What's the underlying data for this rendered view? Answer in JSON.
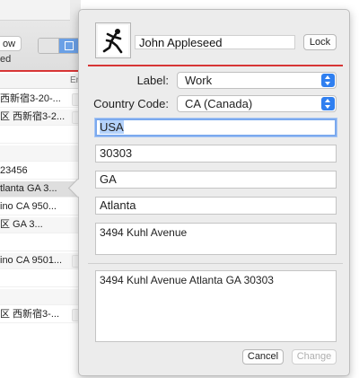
{
  "background_window": {
    "toolbar_button_label": "ow",
    "toolbar_text": "ed",
    "column_header": "Er",
    "rows": [
      "西新宿3-20-...",
      "区 西新宿3-2...",
      "",
      "",
      "23456",
      "tlanta GA 3...",
      "ino CA 950...",
      "区 GA 3...",
      "",
      "ino CA 9501...",
      "",
      "",
      "区 西新宿3-..."
    ]
  },
  "contact": {
    "name": "John Appleseed",
    "lock_label": "Lock"
  },
  "form": {
    "label_caption": "Label:",
    "label_value": "Work",
    "country_caption": "Country Code:",
    "country_value": "CA (Canada)",
    "country_field": "USA",
    "zip_field": "30303",
    "state_field": "GA",
    "city_field": "Atlanta",
    "street_field": "3494 Kuhl Avenue",
    "formatted_address": "3494 Kuhl Avenue Atlanta GA 30303"
  },
  "buttons": {
    "cancel": "Cancel",
    "change": "Change"
  },
  "colors": {
    "accent": "#2f7ff0",
    "separator_red": "#d73535",
    "focus_ring": "#7ba9ee"
  }
}
